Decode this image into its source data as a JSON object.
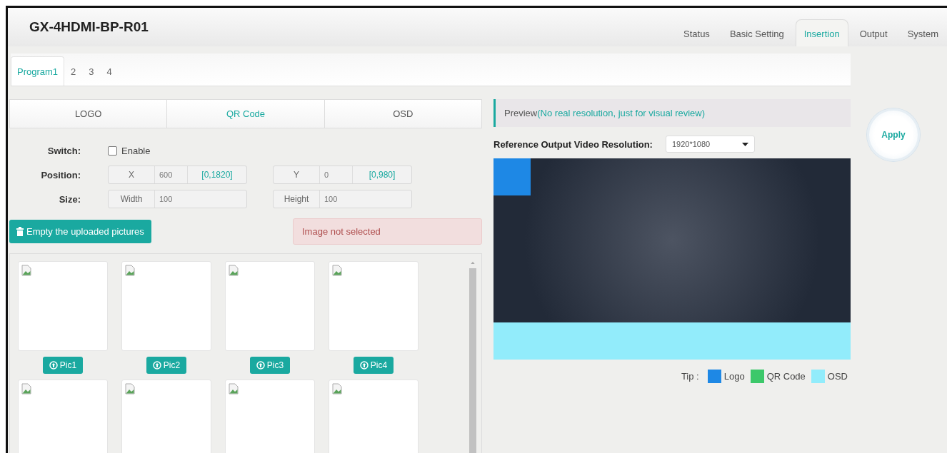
{
  "header": {
    "title": "GX-4HDMI-BP-R01",
    "nav": [
      {
        "label": "Status",
        "selected": false
      },
      {
        "label": "Basic Setting",
        "selected": false
      },
      {
        "label": "Insertion",
        "selected": true
      },
      {
        "label": "Output",
        "selected": false
      },
      {
        "label": "System",
        "selected": false
      }
    ]
  },
  "program_tabs": [
    {
      "label": "Program1",
      "selected": true
    },
    {
      "label": "2",
      "selected": false
    },
    {
      "label": "3",
      "selected": false
    },
    {
      "label": "4",
      "selected": false
    }
  ],
  "insert_tabs": [
    {
      "label": "LOGO",
      "selected": false
    },
    {
      "label": "QR Code",
      "selected": true
    },
    {
      "label": "OSD",
      "selected": false
    }
  ],
  "form": {
    "switch": {
      "label": "Switch:",
      "option": "Enable",
      "checked": false
    },
    "position": {
      "label": "Position:",
      "x": {
        "label": "X",
        "value": "600",
        "range": "[0,1820]"
      },
      "y": {
        "label": "Y",
        "value": "0",
        "range": "[0,980]"
      }
    },
    "size": {
      "label": "Size:",
      "width": {
        "label": "Width",
        "value": "100"
      },
      "height": {
        "label": "Height",
        "value": "100"
      }
    }
  },
  "empty_button": "Empty the uploaded pictures",
  "image_status": "Image not selected",
  "pictures": [
    {
      "kind": "slot",
      "label": "Pic1"
    },
    {
      "kind": "slot",
      "label": "Pic2"
    },
    {
      "kind": "slot",
      "label": "Pic3"
    },
    {
      "kind": "slot",
      "label": "Pic4"
    },
    {
      "kind": "cut"
    },
    {
      "kind": "cut"
    },
    {
      "kind": "cut"
    },
    {
      "kind": "cut"
    }
  ],
  "preview": {
    "title": "Preview",
    "note": "(No real resolution, just for visual review)",
    "resolution_label": "Reference Output Video Resolution:",
    "resolution": "1920*1080",
    "layers": [
      {
        "kind": "logo",
        "color": "#1e88e5"
      },
      {
        "kind": "osd",
        "color": "#92ecfb"
      }
    ],
    "legend": {
      "title": "Tip :",
      "items": [
        {
          "label": "Logo",
          "color": "#1e88e5"
        },
        {
          "label": "QR Code",
          "color": "#3cc86a"
        },
        {
          "label": "OSD",
          "color": "#92ecfb"
        }
      ]
    }
  },
  "apply": "Apply"
}
